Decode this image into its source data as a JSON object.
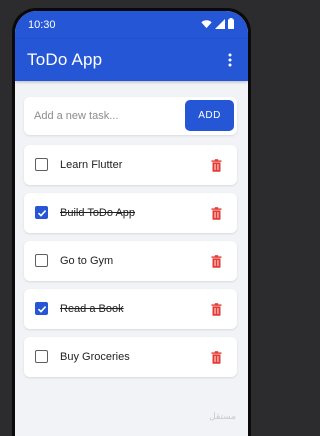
{
  "status_bar": {
    "time": "10:30",
    "icons": [
      "wifi-icon",
      "cellular-signal-icon",
      "battery-icon"
    ]
  },
  "app_bar": {
    "title": "ToDo App",
    "menu_icon": "more-vert-icon"
  },
  "new_task": {
    "value": "",
    "placeholder": "Add a new task...",
    "add_label": "ADD"
  },
  "tasks": [
    {
      "label": "Learn Flutter",
      "completed": false
    },
    {
      "label": "Build ToDo App",
      "completed": true
    },
    {
      "label": "Go to Gym",
      "completed": false
    },
    {
      "label": "Read a Book",
      "completed": true
    },
    {
      "label": "Buy Groceries",
      "completed": false
    }
  ],
  "delete_icon": "trash-icon",
  "colors": {
    "primary": "#2456d6",
    "background": "#f2f3f7",
    "delete": "#e53935",
    "checkbox_border": "#5f5f5f"
  },
  "watermark": "مستقل"
}
